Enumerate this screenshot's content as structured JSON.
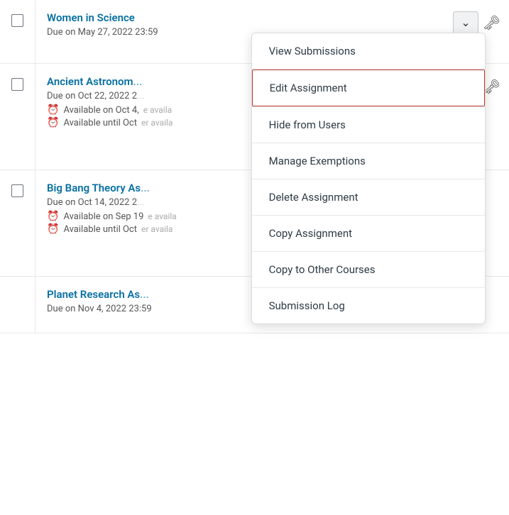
{
  "assignments": [
    {
      "id": "women-in-science",
      "title": "Women in Science",
      "due": "Due on May 27, 2022 23:59",
      "available": [],
      "truncated": false,
      "showDropdown": true,
      "showKey": true
    },
    {
      "id": "ancient-astronomy",
      "title": "Ancient Astronom...",
      "due": "Due on Oct 22, 2022 2...",
      "available": [
        "Available on Oct 4,",
        "Available until Oct"
      ],
      "truncated": true,
      "showDropdown": false,
      "showKey": true
    },
    {
      "id": "big-bang-theory",
      "title": "Big Bang Theory As...",
      "due": "Due on Oct 14, 2022 2...",
      "available": [
        "Available on Sep 19...",
        "Available until Oct"
      ],
      "truncated": true,
      "showDropdown": false,
      "showKey": false
    },
    {
      "id": "planet-research",
      "title": "Planet Research As...",
      "due": "Due on Nov 4, 2022 23:59",
      "available": [],
      "truncated": true,
      "showDropdown": false,
      "showKey": false
    }
  ],
  "menu": {
    "items": [
      {
        "id": "view-submissions",
        "label": "View Submissions",
        "highlighted": false
      },
      {
        "id": "edit-assignment",
        "label": "Edit Assignment",
        "highlighted": true
      },
      {
        "id": "hide-from-users",
        "label": "Hide from Users",
        "highlighted": false
      },
      {
        "id": "manage-exemptions",
        "label": "Manage Exemptions",
        "highlighted": false
      },
      {
        "id": "delete-assignment",
        "label": "Delete Assignment",
        "highlighted": false
      },
      {
        "id": "copy-assignment",
        "label": "Copy Assignment",
        "highlighted": false
      },
      {
        "id": "copy-to-other-courses",
        "label": "Copy to Other Courses",
        "highlighted": false
      },
      {
        "id": "submission-log",
        "label": "Submission Log",
        "highlighted": false
      }
    ]
  },
  "dropdown_chevron": "⌄",
  "key_glyph": "🔑"
}
